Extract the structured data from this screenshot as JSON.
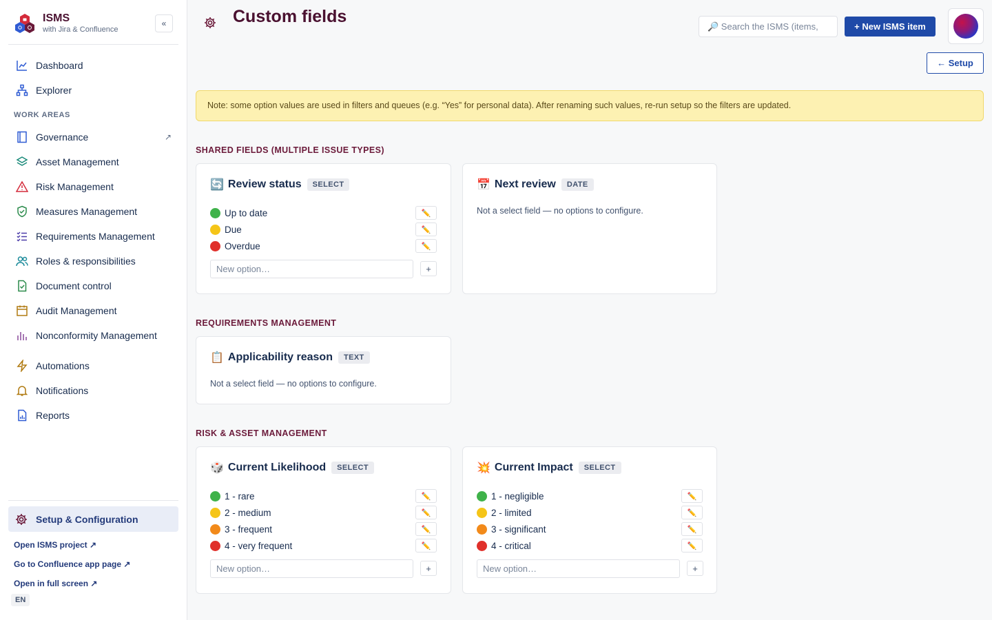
{
  "brand": {
    "title": "ISMS",
    "subtitle": "with Jira & Confluence",
    "collapse_label": "«"
  },
  "nav": {
    "top": [
      {
        "label": "Dashboard",
        "icon": "chart-line-icon"
      },
      {
        "label": "Explorer",
        "icon": "hierarchy-icon"
      }
    ],
    "section_label": "WORK AREAS",
    "areas": [
      {
        "label": "Governance",
        "icon": "book-icon",
        "ext": "↗"
      },
      {
        "label": "Asset Management",
        "icon": "layers-icon"
      },
      {
        "label": "Risk Management",
        "icon": "warning-icon"
      },
      {
        "label": "Measures Management",
        "icon": "shield-check-icon"
      },
      {
        "label": "Requirements Management",
        "icon": "checklist-icon"
      },
      {
        "label": "Roles & responsibilities",
        "icon": "users-icon"
      },
      {
        "label": "Document control",
        "icon": "document-check-icon"
      },
      {
        "label": "Audit Management",
        "icon": "calendar-icon"
      },
      {
        "label": "Nonconformity Management",
        "icon": "bar-chart-icon"
      }
    ],
    "tools": [
      {
        "label": "Automations",
        "icon": "lightning-icon"
      },
      {
        "label": "Notifications",
        "icon": "bell-icon"
      },
      {
        "label": "Reports",
        "icon": "report-icon"
      }
    ],
    "setup_label": "Setup & Configuration",
    "links": [
      "Open ISMS project ↗",
      "Go to Confluence app page ↗",
      "Open in full screen ↗"
    ],
    "lang": "EN"
  },
  "header": {
    "title": "Custom fields",
    "search_placeholder": "🔎 Search the ISMS (items,",
    "new_button": "+ New ISMS item",
    "setup_button": "← Setup"
  },
  "note": "Note: some option values are used in filters and queues (e.g. “Yes” for personal data). After renaming such values, re-run setup so the filters are updated.",
  "groups": {
    "shared": "SHARED FIELDS (MULTIPLE ISSUE TYPES)",
    "requirements": "REQUIREMENTS MANAGEMENT",
    "risk_asset": "RISK & ASSET MANAGEMENT"
  },
  "non_select_note": "Not a select field — no options to configure.",
  "new_option_placeholder": "New option…",
  "add_label": "+",
  "edit_icon": "✏️",
  "fields": {
    "review_status": {
      "emoji": "🔄",
      "title": "Review status",
      "type": "SELECT",
      "options": [
        {
          "label": "Up to date",
          "color": "#3fb24a"
        },
        {
          "label": "Due",
          "color": "#f5c518"
        },
        {
          "label": "Overdue",
          "color": "#e0302b"
        }
      ]
    },
    "next_review": {
      "emoji": "📅",
      "title": "Next review",
      "type": "DATE"
    },
    "applicability_reason": {
      "emoji": "📋",
      "title": "Applicability reason",
      "type": "TEXT"
    },
    "current_likelihood": {
      "emoji": "🎲",
      "title": "Current Likelihood",
      "type": "SELECT",
      "options": [
        {
          "label": "1 - rare",
          "color": "#3fb24a"
        },
        {
          "label": "2 - medium",
          "color": "#f5c518"
        },
        {
          "label": "3 - frequent",
          "color": "#f28a1a"
        },
        {
          "label": "4 - very frequent",
          "color": "#e0302b"
        }
      ]
    },
    "current_impact": {
      "emoji": "💥",
      "title": "Current Impact",
      "type": "SELECT",
      "options": [
        {
          "label": "1 - negligible",
          "color": "#3fb24a"
        },
        {
          "label": "2 - limited",
          "color": "#f5c518"
        },
        {
          "label": "3 - significant",
          "color": "#f28a1a"
        },
        {
          "label": "4 - critical",
          "color": "#e0302b"
        }
      ]
    }
  }
}
